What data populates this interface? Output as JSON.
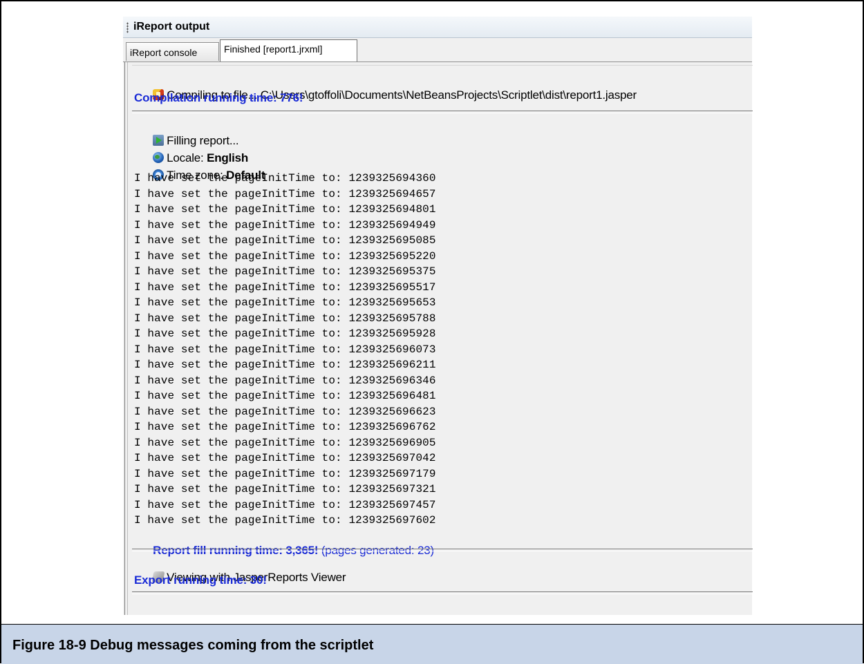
{
  "window": {
    "title": "iReport output",
    "tabs": [
      {
        "label": "iReport console",
        "active": false
      },
      {
        "label": "Finished [report1.jrxml]",
        "active": true
      }
    ]
  },
  "compile": {
    "message": "Compiling to file... C:\\Users\\gtoffoli\\Documents\\NetBeansProjects\\Scriptlet\\dist\\report1.jasper",
    "time_label": "Compilation running time: 776!"
  },
  "fill": {
    "message": "Filling report...",
    "locale_label": "Locale: ",
    "locale_value": "English",
    "timezone_label": "Time zone: ",
    "timezone_value": "Default",
    "debug_lines": [
      "I have set the pageInitTime to: 1239325694360",
      "I have set the pageInitTime to: 1239325694657",
      "I have set the pageInitTime to: 1239325694801",
      "I have set the pageInitTime to: 1239325694949",
      "I have set the pageInitTime to: 1239325695085",
      "I have set the pageInitTime to: 1239325695220",
      "I have set the pageInitTime to: 1239325695375",
      "I have set the pageInitTime to: 1239325695517",
      "I have set the pageInitTime to: 1239325695653",
      "I have set the pageInitTime to: 1239325695788",
      "I have set the pageInitTime to: 1239325695928",
      "I have set the pageInitTime to: 1239325696073",
      "I have set the pageInitTime to: 1239325696211",
      "I have set the pageInitTime to: 1239325696346",
      "I have set the pageInitTime to: 1239325696481",
      "I have set the pageInitTime to: 1239325696623",
      "I have set the pageInitTime to: 1239325696762",
      "I have set the pageInitTime to: 1239325696905",
      "I have set the pageInitTime to: 1239325697042",
      "I have set the pageInitTime to: 1239325697179",
      "I have set the pageInitTime to: 1239325697321",
      "I have set the pageInitTime to: 1239325697457",
      "I have set the pageInitTime to: 1239325697602"
    ],
    "time_label": "Report fill running time: 3,365!",
    "pages_label": " (pages generated: 23)"
  },
  "export": {
    "message": "Viewing with JasperReports Viewer",
    "time_label": "Export running time: 30!"
  },
  "caption": "Figure 18-9    Debug messages coming from the scriptlet",
  "icons": {
    "compile": "compile-icon",
    "fill": "fill-report-icon",
    "locale": "globe-icon",
    "timezone": "clock-icon",
    "viewer": "viewer-icon"
  },
  "colors": {
    "timing_text": "#1a2bd6",
    "caption_background": "#c8d5e8",
    "panel_background": "#f0f0f0"
  }
}
